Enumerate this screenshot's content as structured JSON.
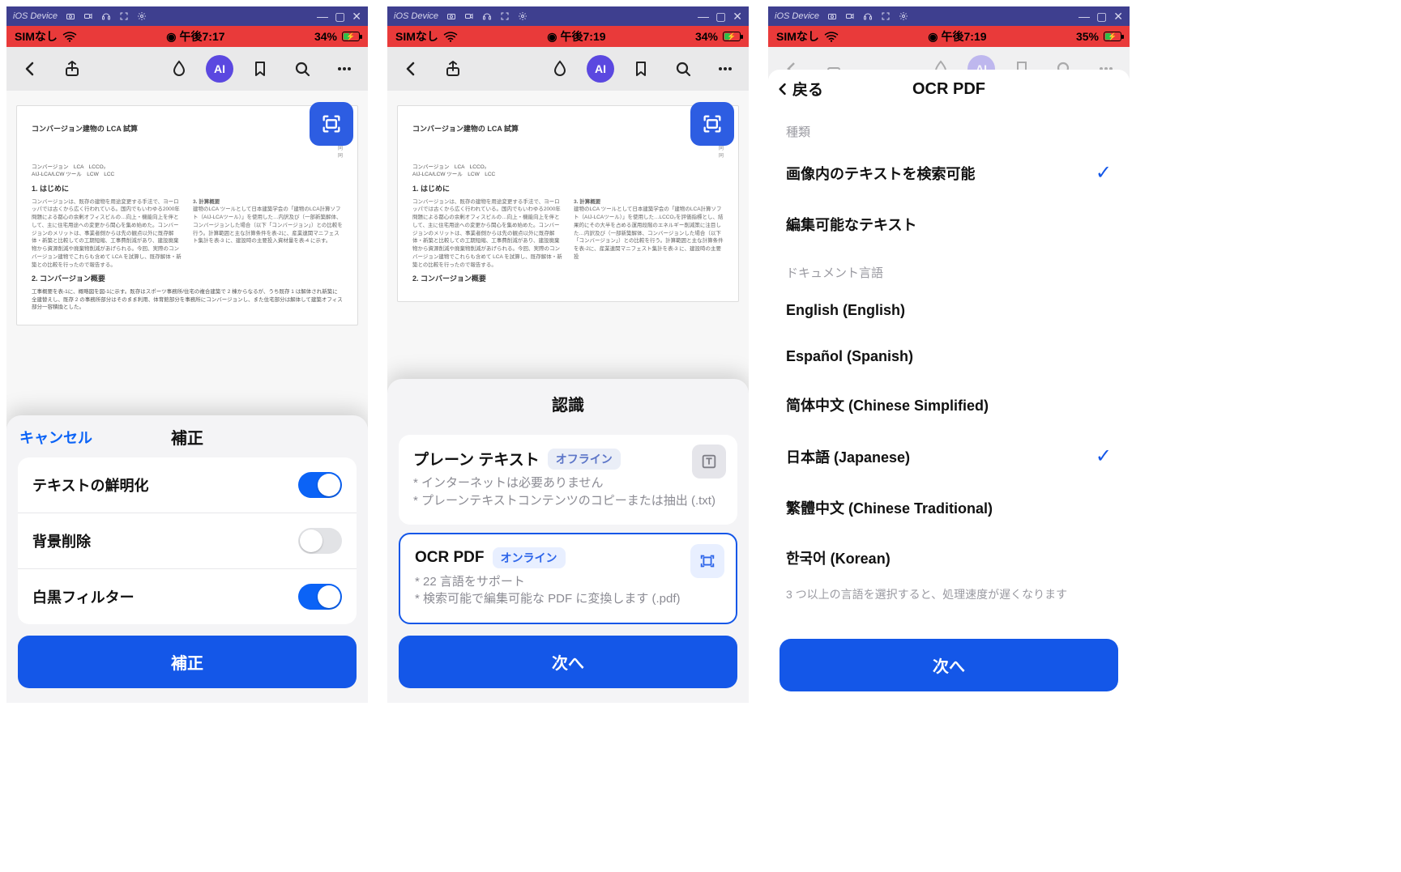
{
  "emu": {
    "device_label": "iOS Device"
  },
  "screen1": {
    "status": {
      "carrier": "SIMなし",
      "time": "午後7:17",
      "battery_text": "34%",
      "battery_pct": 34
    },
    "toolbar": {
      "ai_label": "AI"
    },
    "doc_title": "コンバージョン建物の LCA 試算",
    "sheet": {
      "cancel": "キャンセル",
      "title": "補正",
      "opt_sharpen": "テキストの鮮明化",
      "opt_remove_bg": "背景削除",
      "opt_bw_filter": "白黒フィルター",
      "apply": "補正"
    }
  },
  "screen2": {
    "status": {
      "carrier": "SIMなし",
      "time": "午後7:19",
      "battery_text": "34%",
      "battery_pct": 34
    },
    "toolbar": {
      "ai_label": "AI"
    },
    "doc_title": "コンバージョン建物の LCA 試算",
    "sheet": {
      "title": "認識",
      "plain": {
        "title": "プレーン テキスト",
        "badge": "オフライン",
        "desc1": "* インターネットは必要ありません",
        "desc2": "* プレーンテキストコンテンツのコピーまたは抽出 (.txt)"
      },
      "ocr": {
        "title": "OCR PDF",
        "badge": "オンライン",
        "desc1": "* 22 言語をサポート",
        "desc2": "* 検索可能で編集可能な PDF に変換します (.pdf)"
      },
      "next": "次へ"
    }
  },
  "screen3": {
    "status": {
      "carrier": "SIMなし",
      "time": "午後7:19",
      "battery_text": "35%",
      "battery_pct": 35
    },
    "toolbar": {
      "ai_label": "AI"
    },
    "nav": {
      "back": "戻る",
      "title": "OCR PDF"
    },
    "type_section": {
      "label": "種類",
      "searchable": "画像内のテキストを検索可能",
      "editable": "編集可能なテキスト"
    },
    "lang_section": {
      "label": "ドキュメント言語",
      "en": "English (English)",
      "es": "Español (Spanish)",
      "zh_cn": "简体中文 (Chinese Simplified)",
      "ja": "日本語 (Japanese)",
      "zh_tw": "繁體中文 (Chinese Traditional)",
      "ko": "한국어 (Korean)",
      "note": "3 つ以上の言語を選択すると、処理速度が遅くなります"
    },
    "next": "次へ"
  }
}
